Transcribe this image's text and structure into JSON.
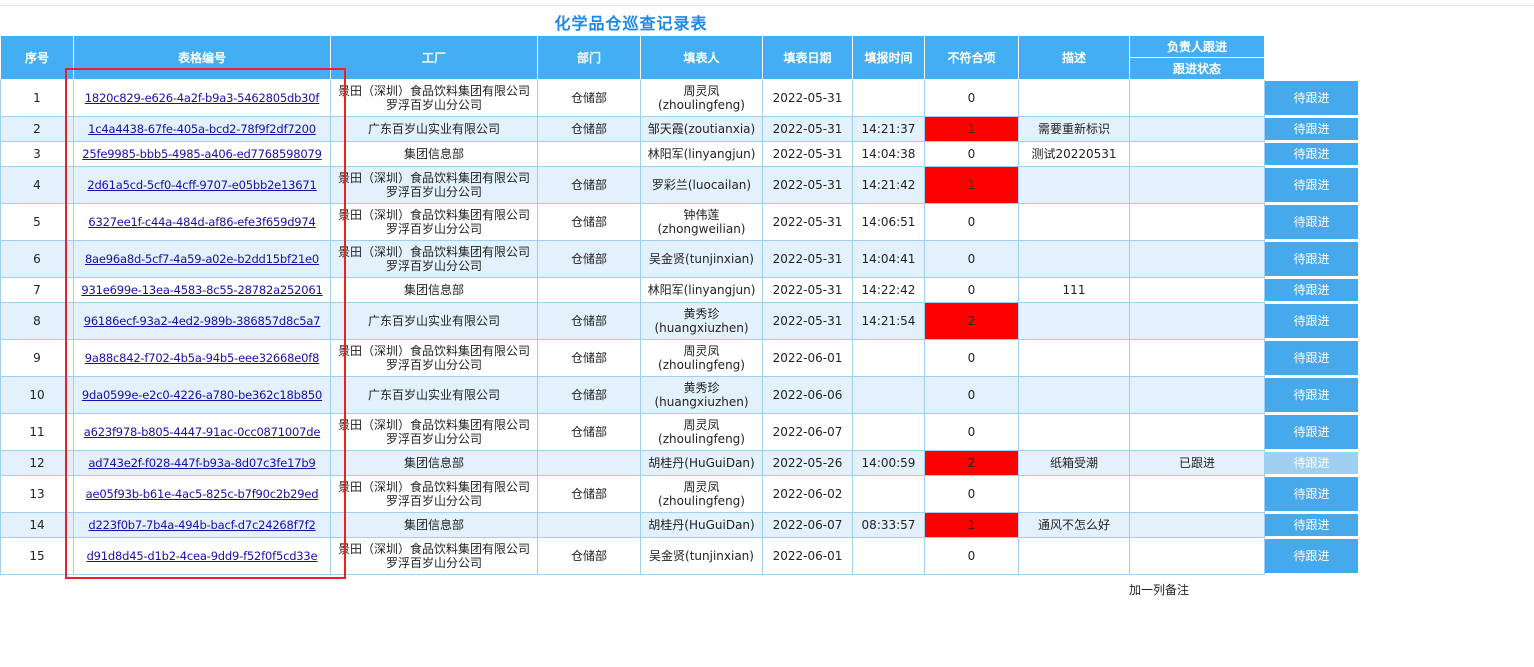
{
  "title": "化学品仓巡查记录表",
  "headers": {
    "seq": "序号",
    "form_no": "表格编号",
    "factory": "工厂",
    "dept": "部门",
    "filler": "填表人",
    "fill_date": "填表日期",
    "report_time": "填报时间",
    "nonconform": "不符合项",
    "desc": "描述",
    "owner_follow": "负责人跟进",
    "follow_status": "跟进状态"
  },
  "colors": {
    "header_bg": "#43aef1",
    "alt_row": "#e3f1fc",
    "flag_red": "#ff0000",
    "button": "#46a9ec",
    "button_done": "#9fcff1",
    "highlight_box": "#e8202a"
  },
  "rows": [
    {
      "seq": "1",
      "id": "1820c829-e626-4a2f-b9a3-5462805db30f",
      "factory": "景田（深圳）食品饮料集团有限公司罗浮百岁山分公司",
      "dept": "仓储部",
      "filler": "周灵凤(zhoulingfeng)",
      "date": "2022-05-31",
      "time": "",
      "count": "0",
      "desc": "",
      "status": "",
      "action": "待跟进"
    },
    {
      "seq": "2",
      "id": "1c4a4438-67fe-405a-bcd2-78f9f2df7200",
      "factory": "广东百岁山实业有限公司",
      "dept": "仓储部",
      "filler": "邹天霞(zoutianxia)",
      "date": "2022-05-31",
      "time": "14:21:37",
      "count": "1",
      "desc": "需要重新标识",
      "status": "",
      "action": "待跟进"
    },
    {
      "seq": "3",
      "id": "25fe9985-bbb5-4985-a406-ed7768598079",
      "factory": "集团信息部",
      "dept": "",
      "filler": "林阳军(linyangjun)",
      "date": "2022-05-31",
      "time": "14:04:38",
      "count": "0",
      "desc": "测试20220531",
      "status": "",
      "action": "待跟进"
    },
    {
      "seq": "4",
      "id": "2d61a5cd-5cf0-4cff-9707-e05bb2e13671",
      "factory": "景田（深圳）食品饮料集团有限公司罗浮百岁山分公司",
      "dept": "仓储部",
      "filler": "罗彩兰(luocailan)",
      "date": "2022-05-31",
      "time": "14:21:42",
      "count": "1",
      "desc": "",
      "status": "",
      "action": "待跟进"
    },
    {
      "seq": "5",
      "id": "6327ee1f-c44a-484d-af86-efe3f659d974",
      "factory": "景田（深圳）食品饮料集团有限公司罗浮百岁山分公司",
      "dept": "仓储部",
      "filler": "钟伟莲(zhongweilian)",
      "date": "2022-05-31",
      "time": "14:06:51",
      "count": "0",
      "desc": "",
      "status": "",
      "action": "待跟进"
    },
    {
      "seq": "6",
      "id": "8ae96a8d-5cf7-4a59-a02e-b2dd15bf21e0",
      "factory": "景田（深圳）食品饮料集团有限公司罗浮百岁山分公司",
      "dept": "仓储部",
      "filler": "吴金贤(tunjinxian)",
      "date": "2022-05-31",
      "time": "14:04:41",
      "count": "0",
      "desc": "",
      "status": "",
      "action": "待跟进"
    },
    {
      "seq": "7",
      "id": "931e699e-13ea-4583-8c55-28782a252061",
      "factory": "集团信息部",
      "dept": "",
      "filler": "林阳军(linyangjun)",
      "date": "2022-05-31",
      "time": "14:22:42",
      "count": "0",
      "desc": "111",
      "status": "",
      "action": "待跟进"
    },
    {
      "seq": "8",
      "id": "96186ecf-93a2-4ed2-989b-386857d8c5a7",
      "factory": "广东百岁山实业有限公司",
      "dept": "仓储部",
      "filler": "黄秀珍(huangxiuzhen)",
      "date": "2022-05-31",
      "time": "14:21:54",
      "count": "2",
      "desc": "",
      "status": "",
      "action": "待跟进"
    },
    {
      "seq": "9",
      "id": "9a88c842-f702-4b5a-94b5-eee32668e0f8",
      "factory": "景田（深圳）食品饮料集团有限公司罗浮百岁山分公司",
      "dept": "仓储部",
      "filler": "周灵凤(zhoulingfeng)",
      "date": "2022-06-01",
      "time": "",
      "count": "0",
      "desc": "",
      "status": "",
      "action": "待跟进"
    },
    {
      "seq": "10",
      "id": "9da0599e-e2c0-4226-a780-be362c18b850",
      "factory": "广东百岁山实业有限公司",
      "dept": "仓储部",
      "filler": "黄秀珍(huangxiuzhen)",
      "date": "2022-06-06",
      "time": "",
      "count": "0",
      "desc": "",
      "status": "",
      "action": "待跟进"
    },
    {
      "seq": "11",
      "id": "a623f978-b805-4447-91ac-0cc0871007de",
      "factory": "景田（深圳）食品饮料集团有限公司罗浮百岁山分公司",
      "dept": "仓储部",
      "filler": "周灵凤(zhoulingfeng)",
      "date": "2022-06-07",
      "time": "",
      "count": "0",
      "desc": "",
      "status": "",
      "action": "待跟进"
    },
    {
      "seq": "12",
      "id": "ad743e2f-f028-447f-b93a-8d07c3fe17b9",
      "factory": "集团信息部",
      "dept": "",
      "filler": "胡桂丹(HuGuiDan)",
      "date": "2022-05-26",
      "time": "14:00:59",
      "count": "2",
      "desc": "纸箱受潮",
      "status": "已跟进",
      "action": "待跟进"
    },
    {
      "seq": "13",
      "id": "ae05f93b-b61e-4ac5-825c-b7f90c2b29ed",
      "factory": "景田（深圳）食品饮料集团有限公司罗浮百岁山分公司",
      "dept": "仓储部",
      "filler": "周灵凤(zhoulingfeng)",
      "date": "2022-06-02",
      "time": "",
      "count": "0",
      "desc": "",
      "status": "",
      "action": "待跟进"
    },
    {
      "seq": "14",
      "id": "d223f0b7-7b4a-494b-bacf-d7c24268f7f2",
      "factory": "集团信息部",
      "dept": "",
      "filler": "胡桂丹(HuGuiDan)",
      "date": "2022-06-07",
      "time": "08:33:57",
      "count": "1",
      "desc": "通风不怎么好",
      "status": "",
      "action": "待跟进"
    },
    {
      "seq": "15",
      "id": "d91d8d45-d1b2-4cea-9dd9-f52f0f5cd33e",
      "factory": "景田（深圳）食品饮料集团有限公司罗浮百岁山分公司",
      "dept": "仓储部",
      "filler": "吴金贤(tunjinxian)",
      "date": "2022-06-01",
      "time": "",
      "count": "0",
      "desc": "",
      "status": "",
      "action": "待跟进"
    }
  ],
  "footer_note": "加一列备注"
}
